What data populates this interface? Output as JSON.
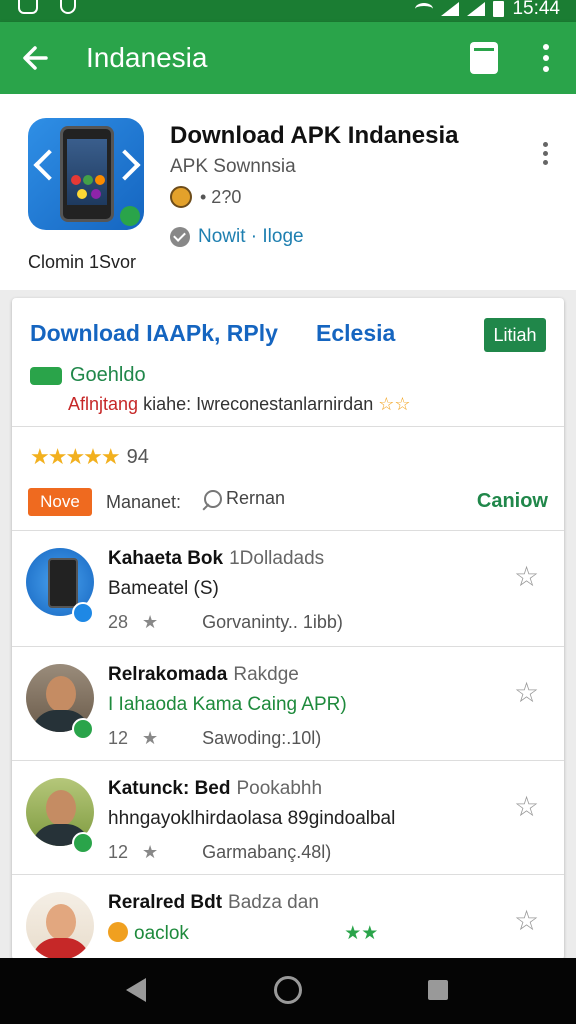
{
  "status_bar": {
    "time": "15:44"
  },
  "app_bar": {
    "title": "Indanesia"
  },
  "header": {
    "app_name": "Download APK Indanesia",
    "publisher": "APK Sownnsia",
    "rating_count": "• 2?0",
    "verified_text": "Nowit · Iloge",
    "caption": "Clomin 1Svor"
  },
  "card": {
    "title": "Download IAAPk, RPly",
    "title_right": "Eclesia",
    "action_button": "Litiah",
    "chip_label": "Goehldo",
    "tagline_red": "Aflnjtang",
    "tagline_rest": "kiahe: Iwreconestanlarnirdan",
    "tagline_stars": "☆☆",
    "rating_stars": "★★★★★",
    "rating_value": "94",
    "filter_chip": "Nove",
    "filter_label": "Mananet:",
    "search_label": "Rernan",
    "link_right": "Caniow"
  },
  "list": [
    {
      "name": "Kahaeta Bok",
      "name_sub": "1Dolladads",
      "desc": "Bameatel (S)",
      "count": "28",
      "meta": "Gorvaninty.. 1ibb)"
    },
    {
      "name": "Relrakomada",
      "name_sub": "Rakdge",
      "desc": "I Iahaoda Kama Caing APR)",
      "count": "12",
      "meta": "Sawoding:.10l)"
    },
    {
      "name": "Katunck: Bed",
      "name_sub": "Pookabhh",
      "desc": "hhngayoklhirdaolasa 89gindoalbal",
      "count": "12",
      "meta": "Garmabanç.48l)"
    },
    {
      "name": "Reralred Bdt",
      "name_sub": "Badza dan",
      "desc": "oaclok",
      "desc_stars": "★★",
      "count": "",
      "meta": ""
    }
  ],
  "icons": {
    "back": "arrow-left-icon",
    "document": "document-icon",
    "overflow": "more-vert-icon",
    "star_outline": "star-outline-icon"
  },
  "colors": {
    "primary": "#2aa44a",
    "status": "#1b7d33",
    "accent_blue": "#1565c0",
    "orange": "#ef6a1f"
  }
}
